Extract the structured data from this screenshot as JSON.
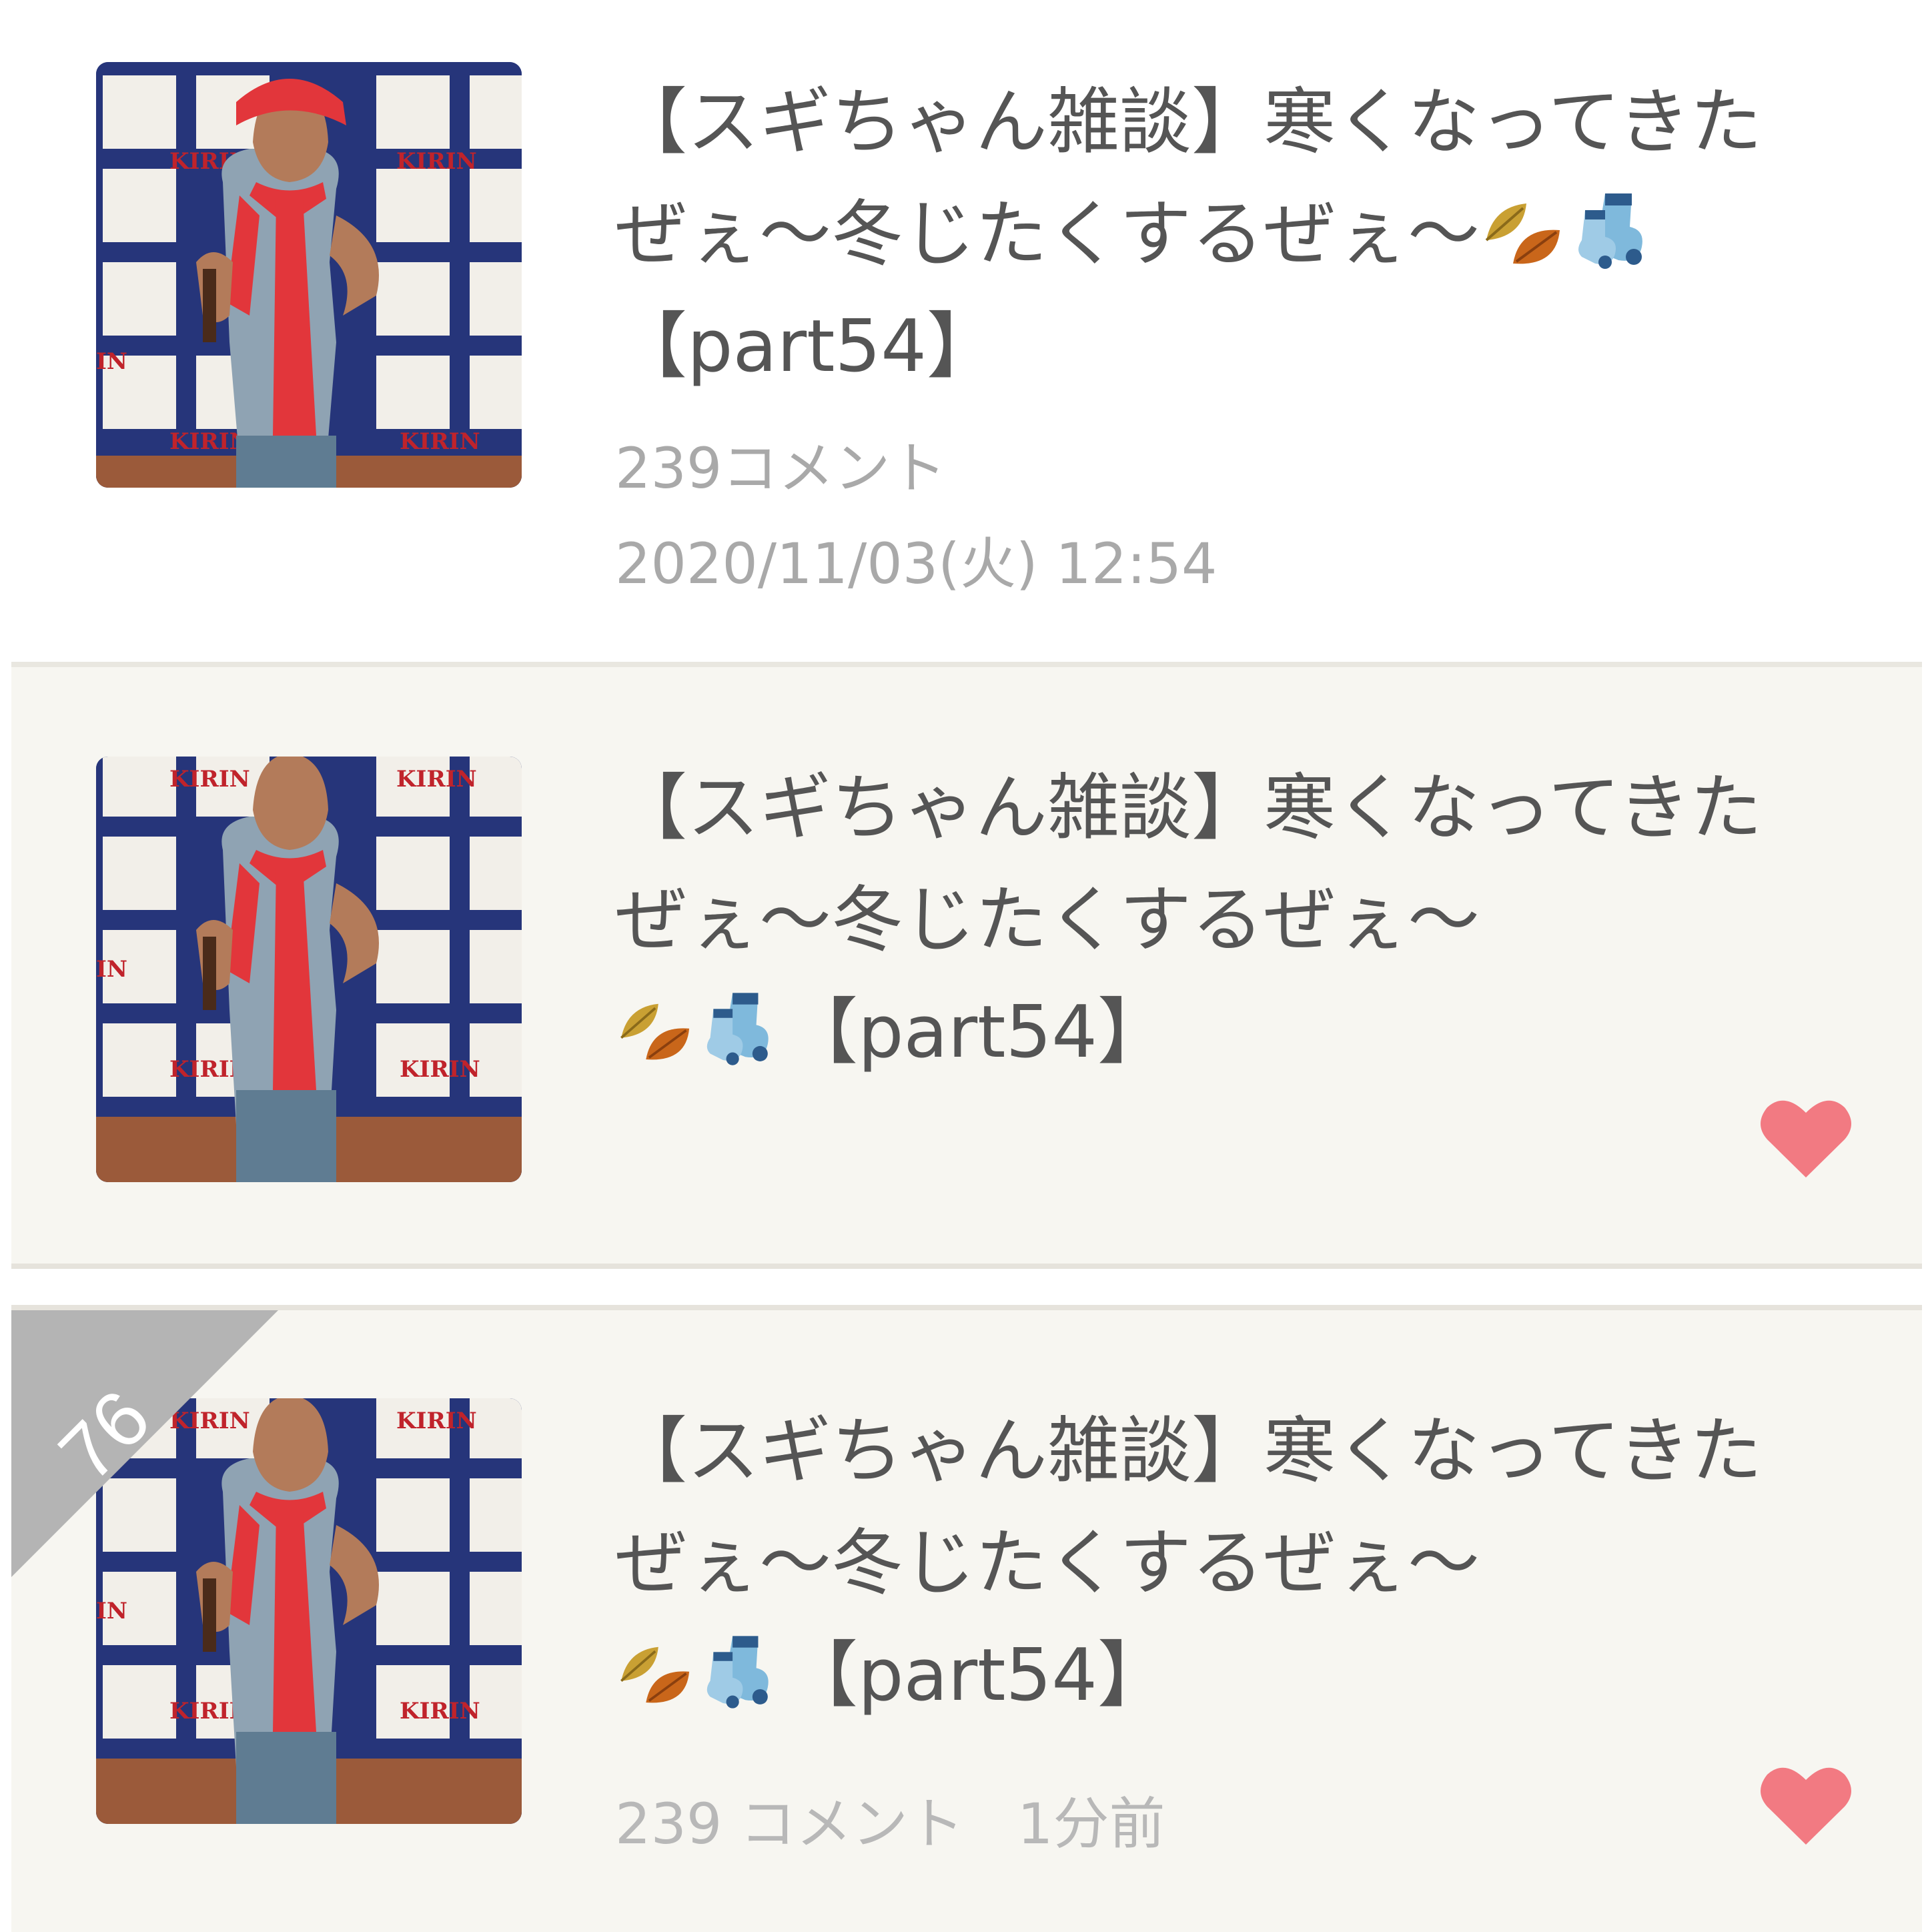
{
  "topics": [
    {
      "title_lines": [
        "【スギちゃん雑談】寒くなってきた",
        "ぜぇ〜冬じたくするぜぇ〜",
        "【part54】"
      ],
      "comments": "239コメント",
      "datetime": "2020/11/03(火) 12:54",
      "emoji": [
        "fallen-leaves-icon",
        "socks-icon"
      ]
    },
    {
      "title_lines": [
        "【スギちゃん雑談】寒くなってきた",
        "ぜぇ〜冬じたくするぜぇ〜",
        "【part54】"
      ],
      "emoji": [
        "fallen-leaves-icon",
        "socks-icon"
      ],
      "favorited": true
    },
    {
      "rank": "76",
      "title_lines": [
        "【スギちゃん雑談】寒くなってきた",
        "ぜぇ〜冬じたくするぜぇ〜",
        "【part54】"
      ],
      "comments": "239 コメント",
      "time_ago": "1分前",
      "emoji": [
        "fallen-leaves-icon",
        "socks-icon"
      ],
      "favorited": true
    }
  ],
  "colors": {
    "heart": "#f27a82",
    "rank_ribbon": "#b4b4b4",
    "title_text": "#555555",
    "meta_text": "#aaaaaa",
    "card_bg": "#f7f6f1"
  }
}
